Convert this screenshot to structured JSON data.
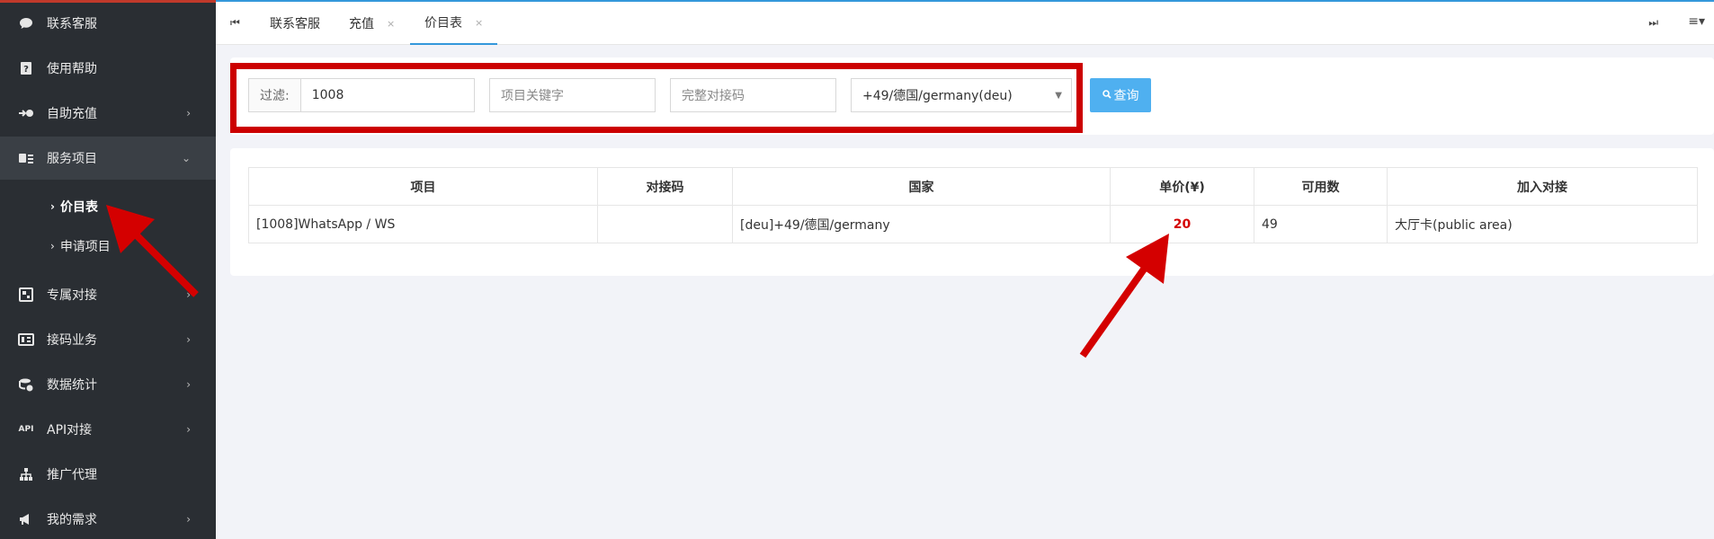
{
  "sidebar": {
    "items": [
      {
        "label": "联系客服",
        "icon": "chat-icon",
        "has_chevron": false
      },
      {
        "label": "使用帮助",
        "icon": "help-icon",
        "has_chevron": false
      },
      {
        "label": "自助充值",
        "icon": "recharge-icon",
        "has_chevron": true
      },
      {
        "label": "服务项目",
        "icon": "service-icon",
        "has_chevron": true,
        "expanded": true
      },
      {
        "label": "专属对接",
        "icon": "exclusive-icon",
        "has_chevron": true
      },
      {
        "label": "接码业务",
        "icon": "code-icon",
        "has_chevron": true
      },
      {
        "label": "数据统计",
        "icon": "stats-icon",
        "has_chevron": true
      },
      {
        "label": "API对接",
        "icon": "api-icon",
        "icon_text": "API",
        "has_chevron": true
      },
      {
        "label": "推广代理",
        "icon": "sitemap-icon",
        "has_chevron": false
      },
      {
        "label": "我的需求",
        "icon": "megaphone-icon",
        "has_chevron": true
      }
    ],
    "sub_items": [
      {
        "label": "价目表",
        "current": true
      },
      {
        "label": "申请项目",
        "current": false
      }
    ]
  },
  "tabs": [
    {
      "label": "联系客服",
      "closable": false,
      "active": false
    },
    {
      "label": "充值",
      "closable": true,
      "active": false
    },
    {
      "label": "价目表",
      "closable": true,
      "active": true
    }
  ],
  "filter": {
    "prefix_label": "过滤:",
    "project_id_value": "1008",
    "keyword_placeholder": "项目关键字",
    "code_placeholder": "完整对接码",
    "country_selected": "+49/德国/germany(deu)",
    "query_label": "查询"
  },
  "table": {
    "headers": [
      "项目",
      "对接码",
      "国家",
      "单价(¥)",
      "可用数",
      "加入对接"
    ],
    "rows": [
      {
        "project": "[1008]WhatsApp / WS",
        "code": "",
        "country": "[deu]+49/德国/germany",
        "price": "20",
        "available": "49",
        "join": "大厅卡(public area)"
      }
    ]
  },
  "colors": {
    "sidebar_bg": "#2a2e33",
    "accent": "#3498db",
    "button": "#4fb0f0",
    "price": "#d40000",
    "annotation": "#cc0000"
  }
}
